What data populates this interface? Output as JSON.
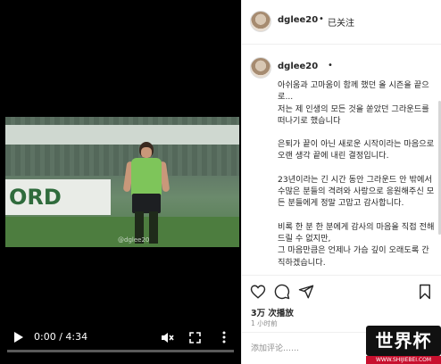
{
  "video": {
    "frame": {
      "banner_text": "",
      "board_text": "ORD",
      "watermark": "@dglee20"
    },
    "controls": {
      "current_time": "0:00",
      "duration": "4:34",
      "time_separator": " / ",
      "progress_fraction": 0.0
    }
  },
  "post": {
    "header": {
      "username": "dglee20",
      "separator": "•",
      "follow_status": "已关注"
    },
    "caption": {
      "username": "dglee20",
      "mark": "•",
      "paragraphs": [
        "아쉬움과 고마움이 함께 했던 올 시즌을 끝으로...\n저는 제 인생의 모든 것을 쏟았던 그라운드를 떠나기로 했습니다",
        "은퇴가 끝이 아닌 새로운 시작이라는 마음으로 오랜 생각 끝에 내린 결정입니다.",
        "23년이라는 긴 시간 동안 그라운드 안 밖에서 수많은 분들의 격려와 사랑으로 응원해주신 모든 분들에게 정말 고맙고 감사합니다.",
        "비록 한 분 한 분에게 감사의 마음을 직접 전해드릴 수 없지만,\n그 마음만큼은 언제나 가슴 깊이 오래도록 간직하겠습니다."
      ]
    },
    "actions": {
      "views": "3万 次播放",
      "time_ago": "1 小时前",
      "comment_placeholder": "添加评论……"
    }
  },
  "site_logo": {
    "text": "世界杯",
    "url": "WWW.SHIJIEBEI.COM"
  },
  "colors": {
    "video_bg": "#000000",
    "panel_bg": "#ffffff",
    "text": "#262626",
    "muted": "#8e8e8e",
    "logo_red": "#c8102e"
  },
  "icons": {
    "play": "play-icon",
    "mute": "volume-muted-icon",
    "fullscreen": "fullscreen-icon",
    "more": "more-vertical-icon",
    "like": "heart-icon",
    "comment": "comment-icon",
    "share": "share-icon",
    "save": "bookmark-icon"
  }
}
